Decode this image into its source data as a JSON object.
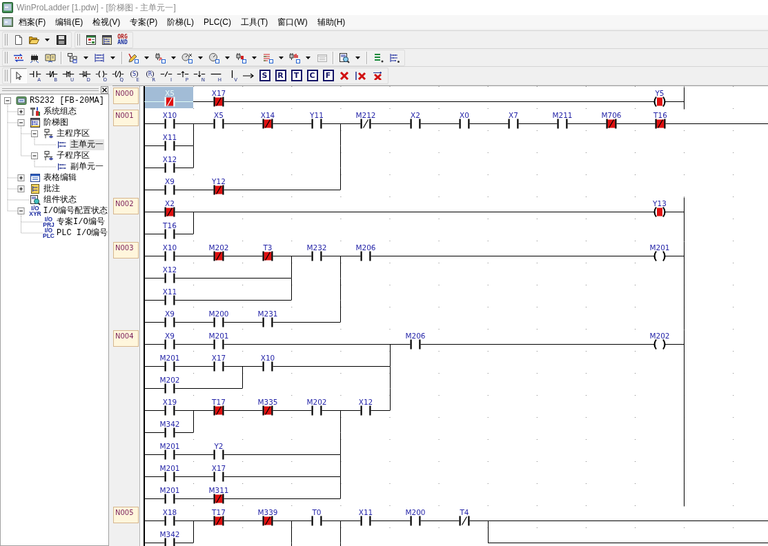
{
  "window": {
    "title": "WinProLadder [1.pdw] - [阶梯图 - 主单元一]"
  },
  "menu": [
    "档案(F)",
    "编辑(E)",
    "检视(V)",
    "专案(P)",
    "阶梯(L)",
    "PLC(C)",
    "工具(T)",
    "窗口(W)",
    "辅助(H)"
  ],
  "toolbar_rows": [
    {
      "bands": [
        {
          "groups": [
            [
              {
                "kind": "new-file",
                "dropdown": false,
                "disabled": false
              },
              {
                "kind": "open-folder",
                "dropdown": true,
                "disabled": false
              },
              {
                "kind": "save",
                "dropdown": false,
                "disabled": false
              }
            ]
          ]
        },
        {
          "groups": [
            [
              {
                "kind": "table-view",
                "dropdown": false,
                "disabled": false
              },
              {
                "kind": "ladder-view",
                "dropdown": false,
                "disabled": false
              },
              {
                "kind": "text-pair",
                "lines": [
                  "ORG",
                  "AND"
                ],
                "dropdown": false,
                "disabled": false
              }
            ]
          ]
        }
      ]
    },
    {
      "bands": [
        {
          "groups": [
            [
              {
                "kind": "transfer",
                "dropdown": false,
                "disabled": false
              },
              {
                "kind": "chip",
                "dropdown": false,
                "disabled": false
              },
              {
                "kind": "book",
                "dropdown": false,
                "disabled": false
              }
            ],
            [
              {
                "kind": "tree-view",
                "dropdown": true,
                "disabled": false
              },
              {
                "kind": "grid-view",
                "dropdown": true,
                "disabled": false
              }
            ],
            [
              {
                "kind": "pencil",
                "dropdown": true,
                "disabled": false
              },
              {
                "kind": "plug-wave",
                "dropdown": true,
                "disabled": false
              },
              {
                "kind": "gauge-x",
                "dropdown": true,
                "disabled": false
              },
              {
                "kind": "gauge",
                "dropdown": true,
                "disabled": false
              },
              {
                "kind": "plug",
                "dropdown": true,
                "disabled": false
              },
              {
                "kind": "list",
                "dropdown": true,
                "disabled": false
              },
              {
                "kind": "plug-chart",
                "dropdown": true,
                "disabled": false
              },
              {
                "kind": "window",
                "dropdown": false,
                "disabled": true
              }
            ],
            [
              {
                "kind": "doc-search",
                "dropdown": true,
                "disabled": false
              }
            ],
            [
              {
                "kind": "list-help",
                "dropdown": false,
                "disabled": false
              },
              {
                "kind": "ladder-help",
                "dropdown": false,
                "disabled": false
              }
            ]
          ]
        }
      ]
    },
    {
      "bands": [
        {
          "groups": [
            [
              {
                "kind": "pointer",
                "selected": true
              },
              {
                "kind": "contact-no",
                "key": "A",
                "selected": false
              },
              {
                "kind": "contact-nc",
                "key": "B",
                "selected": false
              },
              {
                "kind": "contact-up",
                "key": "U",
                "selected": false
              },
              {
                "kind": "contact-down",
                "key": "D",
                "selected": false
              },
              {
                "kind": "coil",
                "key": "O",
                "selected": false
              },
              {
                "kind": "coil-inverse",
                "key": "Q",
                "selected": false
              },
              {
                "kind": "coil-letter",
                "letter": "S",
                "key": "E",
                "selected": false
              },
              {
                "kind": "coil-letter",
                "letter": "R",
                "key": "R",
                "selected": false
              },
              {
                "kind": "invert",
                "key": "I",
                "selected": false
              },
              {
                "kind": "pulse-up",
                "key": "P",
                "selected": false
              },
              {
                "kind": "pulse-down",
                "key": "N",
                "selected": false
              },
              {
                "kind": "hline",
                "key": "H",
                "selected": false
              },
              {
                "kind": "vline",
                "key": "V",
                "selected": false
              },
              {
                "kind": "arrow",
                "selected": false
              },
              {
                "kind": "boxed-letter",
                "letter": "S",
                "selected": false
              },
              {
                "kind": "boxed-letter",
                "letter": "R",
                "selected": false
              },
              {
                "kind": "boxed-letter",
                "letter": "T",
                "selected": false
              },
              {
                "kind": "boxed-letter",
                "letter": "C",
                "selected": false
              },
              {
                "kind": "boxed-letter",
                "letter": "F",
                "selected": false
              },
              {
                "kind": "delete",
                "selected": false
              },
              {
                "kind": "delete-bar",
                "selected": false
              },
              {
                "kind": "delete-arrow",
                "selected": false
              }
            ]
          ]
        }
      ]
    }
  ],
  "tree": [
    {
      "label": "RS232 [FB-20MA]",
      "kind": "plc",
      "expanded": true,
      "selected": false,
      "children": [
        {
          "label": "系统组态",
          "kind": "config",
          "expanded": false,
          "selected": false
        },
        {
          "label": "阶梯图",
          "kind": "ladder",
          "expanded": true,
          "selected": false,
          "children": [
            {
              "label": "主程序区",
              "kind": "program",
              "expanded": true,
              "selected": false,
              "children": [
                {
                  "label": "主单元一",
                  "kind": "unit",
                  "selected": true
                }
              ]
            },
            {
              "label": "子程序区",
              "kind": "program",
              "expanded": true,
              "selected": false,
              "children": [
                {
                  "label": "副单元一",
                  "kind": "unit",
                  "selected": false
                }
              ]
            }
          ]
        },
        {
          "label": "表格编辑",
          "kind": "table",
          "expanded": false,
          "selected": false
        },
        {
          "label": "批注",
          "kind": "note",
          "expanded": false,
          "selected": false
        },
        {
          "label": "组件状态",
          "kind": "status",
          "selected": false
        },
        {
          "label": "I/O编号配置状态",
          "kind": "io",
          "icon_text": [
            "I/O",
            "XYR"
          ],
          "expanded": true,
          "selected": false,
          "children": [
            {
              "label": "专案I/O编号",
              "kind": "io",
              "icon_text": [
                "I/O",
                "PRJ"
              ],
              "selected": false
            },
            {
              "label": "PLC I/O编号",
              "kind": "io",
              "icon_text": [
                "I/O",
                "PLC"
              ],
              "selected": false
            }
          ]
        }
      ]
    }
  ],
  "rungs": [
    {
      "label": "N000",
      "rows": [
        {
          "cells": [
            {
              "kind": "nc",
              "name": "X5",
              "on": true,
              "selected": true
            },
            {
              "kind": "nc",
              "name": "X17",
              "on": true,
              "selected": false
            },
            {
              "kind": "wire"
            },
            {
              "kind": "wire"
            },
            {
              "kind": "wire"
            },
            {
              "kind": "wire"
            },
            {
              "kind": "wire"
            },
            {
              "kind": "wire"
            },
            {
              "kind": "wire"
            },
            {
              "kind": "wire"
            },
            {
              "kind": "coil",
              "name": "Y5",
              "on": true,
              "selected": false
            }
          ]
        }
      ]
    },
    {
      "label": "N001",
      "rows": [
        {
          "cells": [
            {
              "kind": "no",
              "name": "X10",
              "on": false,
              "selected": false
            },
            {
              "kind": "join"
            },
            {
              "kind": "no",
              "name": "X5",
              "on": false,
              "selected": false
            },
            {
              "kind": "nc",
              "name": "X14",
              "on": true,
              "selected": false
            },
            {
              "kind": "no",
              "name": "Y11",
              "on": false,
              "selected": false
            },
            {
              "kind": "join"
            },
            {
              "kind": "nc",
              "name": "M212",
              "on": false,
              "selected": false
            },
            {
              "kind": "no",
              "name": "X2",
              "on": false,
              "selected": false
            },
            {
              "kind": "no",
              "name": "X0",
              "on": false,
              "selected": false
            },
            {
              "kind": "no",
              "name": "X7",
              "on": false,
              "selected": false
            },
            {
              "kind": "no",
              "name": "M211",
              "on": false,
              "selected": false
            },
            {
              "kind": "nc",
              "name": "M706",
              "on": true,
              "selected": false
            },
            {
              "kind": "nc",
              "name": "T16",
              "on": true,
              "selected": false
            },
            {
              "kind": "wire"
            },
            {
              "kind": "wire"
            }
          ]
        },
        {
          "cells": [
            {
              "kind": "no",
              "name": "X11",
              "on": false,
              "selected": false
            },
            {
              "kind": "join"
            },
            {
              "kind": "blank"
            },
            {
              "kind": "blank"
            },
            {
              "kind": "blank"
            },
            {
              "kind": "join"
            }
          ]
        },
        {
          "cells": [
            {
              "kind": "no",
              "name": "X12",
              "on": false,
              "selected": false
            },
            {
              "kind": "blank"
            },
            {
              "kind": "blank"
            },
            {
              "kind": "blank"
            },
            {
              "kind": "join"
            }
          ]
        },
        {
          "cells": [
            {
              "kind": "no",
              "name": "X9",
              "on": false,
              "selected": false
            },
            {
              "kind": "nc",
              "name": "Y12",
              "on": true,
              "selected": false
            },
            {
              "kind": "wire"
            },
            {
              "kind": "wire"
            }
          ]
        }
      ]
    },
    {
      "label": "N002",
      "rows": [
        {
          "cells": [
            {
              "kind": "nc",
              "name": "X2",
              "on": true,
              "selected": false
            },
            {
              "kind": "join"
            },
            {
              "kind": "wire"
            },
            {
              "kind": "wire"
            },
            {
              "kind": "wire"
            },
            {
              "kind": "wire"
            },
            {
              "kind": "wire"
            },
            {
              "kind": "wire"
            },
            {
              "kind": "wire"
            },
            {
              "kind": "wire"
            },
            {
              "kind": "wire"
            },
            {
              "kind": "coil",
              "name": "Y13",
              "on": true,
              "selected": false
            }
          ]
        },
        {
          "cells": [
            {
              "kind": "no",
              "name": "T16",
              "on": false,
              "selected": false
            }
          ]
        }
      ]
    },
    {
      "label": "N003",
      "rows": [
        {
          "cells": [
            {
              "kind": "no",
              "name": "X10",
              "on": false,
              "selected": false
            },
            {
              "kind": "nc",
              "name": "M202",
              "on": true,
              "selected": false
            },
            {
              "kind": "nc",
              "name": "T3",
              "on": true,
              "selected": false
            },
            {
              "kind": "join"
            },
            {
              "kind": "no",
              "name": "M232",
              "on": false,
              "selected": false
            },
            {
              "kind": "join"
            },
            {
              "kind": "no",
              "name": "M206",
              "on": false,
              "selected": false
            },
            {
              "kind": "wire"
            },
            {
              "kind": "wire"
            },
            {
              "kind": "wire"
            },
            {
              "kind": "wire"
            },
            {
              "kind": "wire"
            },
            {
              "kind": "coil",
              "name": "M201",
              "on": false,
              "selected": false
            }
          ]
        },
        {
          "cells": [
            {
              "kind": "no",
              "name": "X12",
              "on": false,
              "selected": false
            },
            {
              "kind": "wire"
            },
            {
              "kind": "wire"
            },
            {
              "kind": "join"
            },
            {
              "kind": "blank"
            },
            {
              "kind": "join"
            }
          ]
        },
        {
          "cells": [
            {
              "kind": "no",
              "name": "X11",
              "on": false,
              "selected": false
            },
            {
              "kind": "wire"
            },
            {
              "kind": "wire"
            },
            {
              "kind": "blank"
            },
            {
              "kind": "join"
            }
          ]
        },
        {
          "cells": [
            {
              "kind": "no",
              "name": "X9",
              "on": false,
              "selected": false
            },
            {
              "kind": "no",
              "name": "M200",
              "on": false,
              "selected": false
            },
            {
              "kind": "no",
              "name": "M231",
              "on": false,
              "selected": false
            },
            {
              "kind": "wire"
            }
          ]
        }
      ]
    },
    {
      "label": "N004",
      "rows": [
        {
          "cells": [
            {
              "kind": "no",
              "name": "X9",
              "on": false,
              "selected": false
            },
            {
              "kind": "no",
              "name": "M201",
              "on": false,
              "selected": false
            },
            {
              "kind": "wire"
            },
            {
              "kind": "wire"
            },
            {
              "kind": "wire"
            },
            {
              "kind": "join"
            },
            {
              "kind": "no",
              "name": "M206",
              "on": false,
              "selected": false
            },
            {
              "kind": "wire"
            },
            {
              "kind": "wire"
            },
            {
              "kind": "wire"
            },
            {
              "kind": "wire"
            },
            {
              "kind": "coil",
              "name": "M202",
              "on": false,
              "selected": false
            }
          ]
        },
        {
          "cells": [
            {
              "kind": "no",
              "name": "M201",
              "on": false,
              "selected": false
            },
            {
              "kind": "no",
              "name": "X17",
              "on": false,
              "selected": false
            },
            {
              "kind": "join"
            },
            {
              "kind": "no",
              "name": "X10",
              "on": false,
              "selected": false
            },
            {
              "kind": "wire"
            },
            {
              "kind": "wire"
            },
            {
              "kind": "join"
            }
          ]
        },
        {
          "cells": [
            {
              "kind": "no",
              "name": "M202",
              "on": false,
              "selected": false
            },
            {
              "kind": "wire"
            },
            {
              "kind": "blank"
            },
            {
              "kind": "blank"
            },
            {
              "kind": "blank"
            },
            {
              "kind": "join"
            }
          ]
        },
        {
          "cells": [
            {
              "kind": "no",
              "name": "X19",
              "on": false,
              "selected": false
            },
            {
              "kind": "join"
            },
            {
              "kind": "nc",
              "name": "T17",
              "on": true,
              "selected": false
            },
            {
              "kind": "nc",
              "name": "M335",
              "on": true,
              "selected": false
            },
            {
              "kind": "no",
              "name": "M202",
              "on": false,
              "selected": false
            },
            {
              "kind": "join"
            },
            {
              "kind": "no",
              "name": "X12",
              "on": false,
              "selected": false
            }
          ]
        },
        {
          "cells": [
            {
              "kind": "no",
              "name": "M342",
              "on": false,
              "selected": false
            },
            {
              "kind": "blank"
            },
            {
              "kind": "blank"
            },
            {
              "kind": "blank"
            },
            {
              "kind": "join"
            }
          ]
        },
        {
          "cells": [
            {
              "kind": "no",
              "name": "M201",
              "on": false,
              "selected": false
            },
            {
              "kind": "no",
              "name": "Y2",
              "on": false,
              "selected": false
            },
            {
              "kind": "wire"
            },
            {
              "kind": "wire"
            },
            {
              "kind": "join"
            }
          ]
        },
        {
          "cells": [
            {
              "kind": "no",
              "name": "M201",
              "on": false,
              "selected": false
            },
            {
              "kind": "no",
              "name": "X17",
              "on": false,
              "selected": false
            },
            {
              "kind": "wire"
            },
            {
              "kind": "wire"
            },
            {
              "kind": "join"
            }
          ]
        },
        {
          "cells": [
            {
              "kind": "no",
              "name": "M201",
              "on": false,
              "selected": false
            },
            {
              "kind": "nc",
              "name": "M311",
              "on": true,
              "selected": false
            },
            {
              "kind": "wire"
            },
            {
              "kind": "wire"
            }
          ]
        }
      ]
    },
    {
      "label": "N005",
      "rows": [
        {
          "cells": [
            {
              "kind": "no",
              "name": "X18",
              "on": false,
              "selected": false
            },
            {
              "kind": "join"
            },
            {
              "kind": "nc",
              "name": "T17",
              "on": true,
              "selected": false
            },
            {
              "kind": "nc",
              "name": "M339",
              "on": true,
              "selected": false
            },
            {
              "kind": "join"
            },
            {
              "kind": "no",
              "name": "T0",
              "on": false,
              "selected": false
            },
            {
              "kind": "join"
            },
            {
              "kind": "no",
              "name": "X11",
              "on": false,
              "selected": false
            },
            {
              "kind": "no",
              "name": "M200",
              "on": false,
              "selected": false
            },
            {
              "kind": "nc",
              "name": "T4",
              "on": false,
              "selected": false
            },
            {
              "kind": "join"
            },
            {
              "kind": "wire"
            },
            {
              "kind": "wire"
            },
            {
              "kind": "wire"
            },
            {
              "kind": "wire"
            },
            {
              "kind": "wire"
            },
            {
              "kind": "wire"
            }
          ]
        },
        {
          "cells": [
            {
              "kind": "no",
              "name": "M342",
              "on": false,
              "selected": false
            },
            {
              "kind": "blank"
            },
            {
              "kind": "blank"
            },
            {
              "kind": "join"
            },
            {
              "kind": "blank"
            },
            {
              "kind": "join"
            },
            {
              "kind": "blank"
            },
            {
              "kind": "blank"
            },
            {
              "kind": "blank"
            },
            {
              "kind": "wire"
            },
            {
              "kind": "wire"
            },
            {
              "kind": "wire"
            },
            {
              "kind": "wire"
            },
            {
              "kind": "wire"
            },
            {
              "kind": "wire"
            }
          ]
        }
      ]
    }
  ]
}
